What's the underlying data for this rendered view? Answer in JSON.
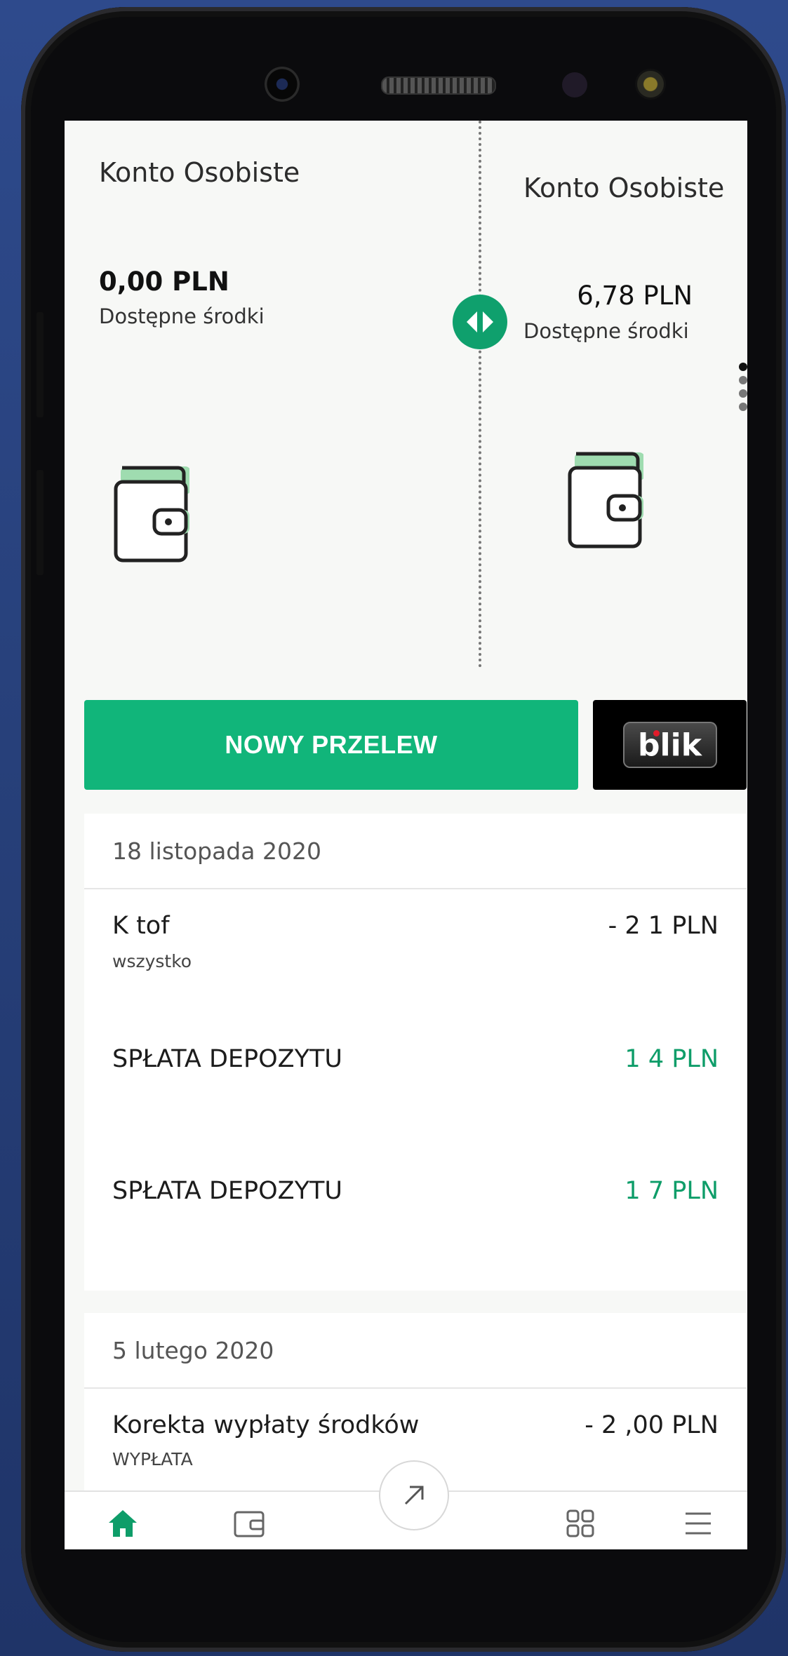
{
  "accounts": [
    {
      "name": "Konto Osobiste",
      "balance": "0,00 PLN",
      "balance_label": "Dostępne środki"
    },
    {
      "name": "Konto Osobiste",
      "balance": "6,78 PLN",
      "balance_label": "Dostępne środki"
    }
  ],
  "actions": {
    "transfer_label": "NOWY PRZELEW",
    "blik_label": "blik"
  },
  "history": [
    {
      "date": "18 listopada 2020",
      "transactions": [
        {
          "title": "K                 tof",
          "subtitle": "wszystko",
          "amount": "- 2 1 PLN",
          "direction": "out"
        },
        {
          "title": "SPŁATA DEPOZYTU",
          "subtitle": "",
          "amount": "1 4 PLN",
          "direction": "in"
        },
        {
          "title": "SPŁATA DEPOZYTU",
          "subtitle": "",
          "amount": "1 7 PLN",
          "direction": "in"
        }
      ]
    },
    {
      "date": "5 lutego 2020",
      "transactions": [
        {
          "title": "Korekta wypłaty środków",
          "subtitle": "WYPŁATA",
          "amount": "- 2   ,00 PLN",
          "direction": "out"
        }
      ]
    }
  ],
  "nav": {
    "items": [
      "home-icon",
      "wallet-icon",
      "transfer-arrow-icon",
      "grid-icon",
      "menu-icon"
    ],
    "active": "home-icon"
  },
  "colors": {
    "accent": "#11b57a",
    "positive_amount": "#0e9d69",
    "blik_bg": "#000000",
    "screen_bg": "#f7f8f6"
  }
}
